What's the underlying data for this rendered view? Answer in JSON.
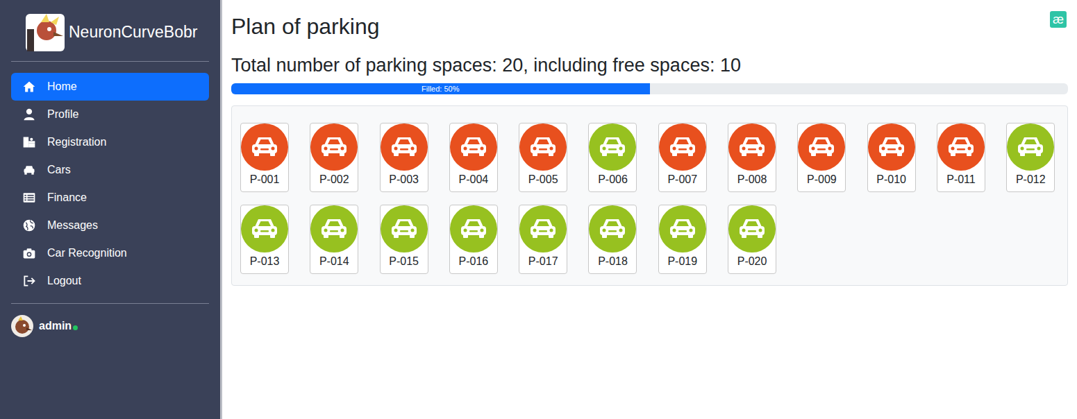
{
  "brand": {
    "name": "NeuronCurveBobr"
  },
  "sidebar": {
    "items": [
      {
        "label": "Home",
        "selected": true
      },
      {
        "label": "Profile",
        "selected": false
      },
      {
        "label": "Registration",
        "selected": false
      },
      {
        "label": "Cars",
        "selected": false
      },
      {
        "label": "Finance",
        "selected": false
      },
      {
        "label": "Messages",
        "selected": false
      },
      {
        "label": "Car Recognition",
        "selected": false
      },
      {
        "label": "Logout",
        "selected": false
      }
    ]
  },
  "user": {
    "name": "admin",
    "online": true
  },
  "header": {
    "badge": "æ"
  },
  "page": {
    "title": "Plan of parking",
    "summary": "Total number of parking spaces: 20, including free spaces: 10"
  },
  "progress": {
    "label": "Filled: 50%",
    "level": 0.5
  },
  "spots": [
    {
      "label": "P-001",
      "occupied": true
    },
    {
      "label": "P-002",
      "occupied": true
    },
    {
      "label": "P-003",
      "occupied": true
    },
    {
      "label": "P-004",
      "occupied": true
    },
    {
      "label": "P-005",
      "occupied": true
    },
    {
      "label": "P-006",
      "occupied": false
    },
    {
      "label": "P-007",
      "occupied": true
    },
    {
      "label": "P-008",
      "occupied": true
    },
    {
      "label": "P-009",
      "occupied": true
    },
    {
      "label": "P-010",
      "occupied": true
    },
    {
      "label": "P-011",
      "occupied": true
    },
    {
      "label": "P-012",
      "occupied": false
    },
    {
      "label": "P-013",
      "occupied": false
    },
    {
      "label": "P-014",
      "occupied": false
    },
    {
      "label": "P-015",
      "occupied": false
    },
    {
      "label": "P-016",
      "occupied": false
    },
    {
      "label": "P-017",
      "occupied": false
    },
    {
      "label": "P-018",
      "occupied": false
    },
    {
      "label": "P-019",
      "occupied": false
    },
    {
      "label": "P-020",
      "occupied": false
    }
  ]
}
